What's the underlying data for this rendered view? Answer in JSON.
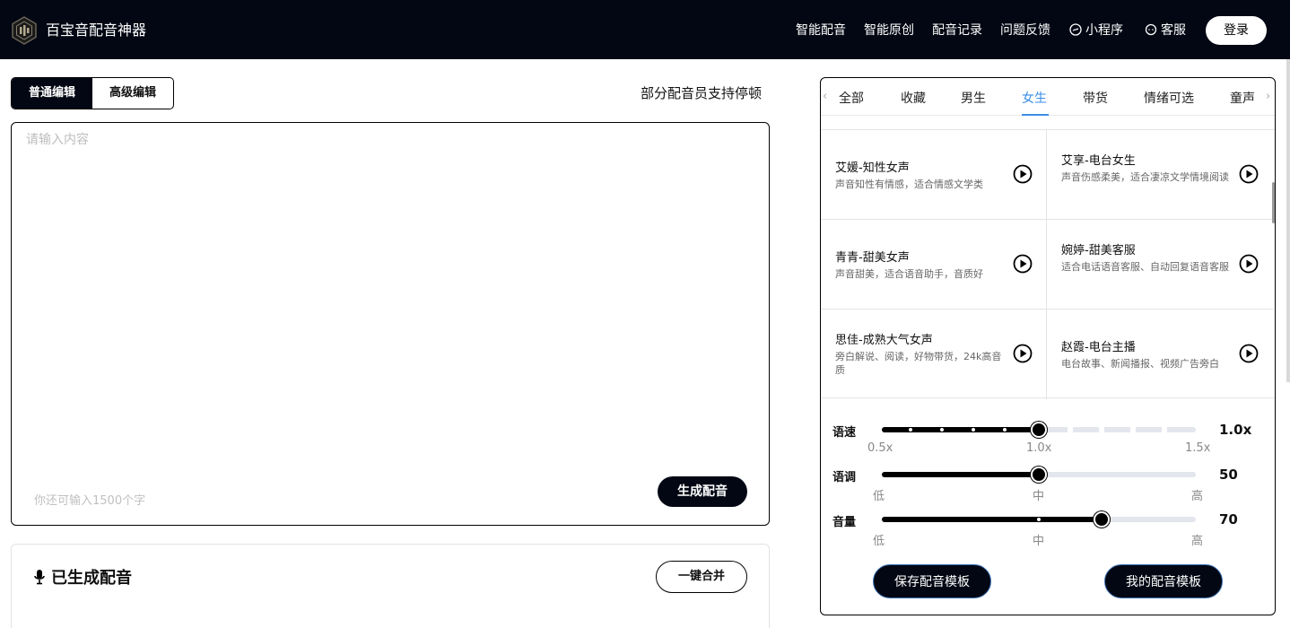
{
  "header": {
    "title": "百宝音配音神器",
    "nav": [
      "智能配音",
      "智能原创",
      "配音记录",
      "问题反馈",
      "小程序",
      "客服"
    ],
    "login": "登录"
  },
  "editor": {
    "tabs": [
      "普通编辑",
      "高级编辑"
    ],
    "active_tab": "普通编辑",
    "pause_note": "部分配音员支持停顿",
    "placeholder": "请输入内容",
    "value": "",
    "remaining": "你还可输入1500个字",
    "generate": "生成配音"
  },
  "generated": {
    "title": "已生成配音",
    "merge": "一键合并"
  },
  "voice_panel": {
    "categories": [
      "全部",
      "收藏",
      "男生",
      "女生",
      "带货",
      "情绪可选",
      "童声"
    ],
    "active_category": "女生",
    "voices": [
      {
        "name": "艾媛-知性女声",
        "desc": "声音知性有情感，适合情感文学类"
      },
      {
        "name": "艾享-电台女生",
        "desc": "声音伤感柔美，适合凄凉文学情境阅读"
      },
      {
        "name": "青青-甜美女声",
        "desc": "声音甜美，适合语音助手，音质好"
      },
      {
        "name": "婉婷-甜美客服",
        "desc": "适合电话语音客服、自动回复语音客服"
      },
      {
        "name": "思佳-成熟大气女声",
        "desc": "旁白解说、阅读，好物带货，24k高音质"
      },
      {
        "name": "赵霞-电台主播",
        "desc": "电台故事、新闻播报、视频广告旁白"
      }
    ],
    "speed": {
      "label": "语速",
      "value": "1.0x",
      "level": 0.5,
      "ticks": [
        "0.5x",
        "1.0x",
        "1.5x"
      ]
    },
    "pitch": {
      "label": "语调",
      "value": "50",
      "level": 0.5,
      "ticks": [
        "低",
        "中",
        "高"
      ]
    },
    "volume": {
      "label": "音量",
      "value": "70",
      "level": 0.7,
      "ticks": [
        "低",
        "中",
        "高"
      ]
    },
    "save_template": "保存配音模板",
    "my_templates": "我的配音模板"
  },
  "colors": {
    "header_bg": "#020713",
    "accent": "#3a8ee6"
  }
}
